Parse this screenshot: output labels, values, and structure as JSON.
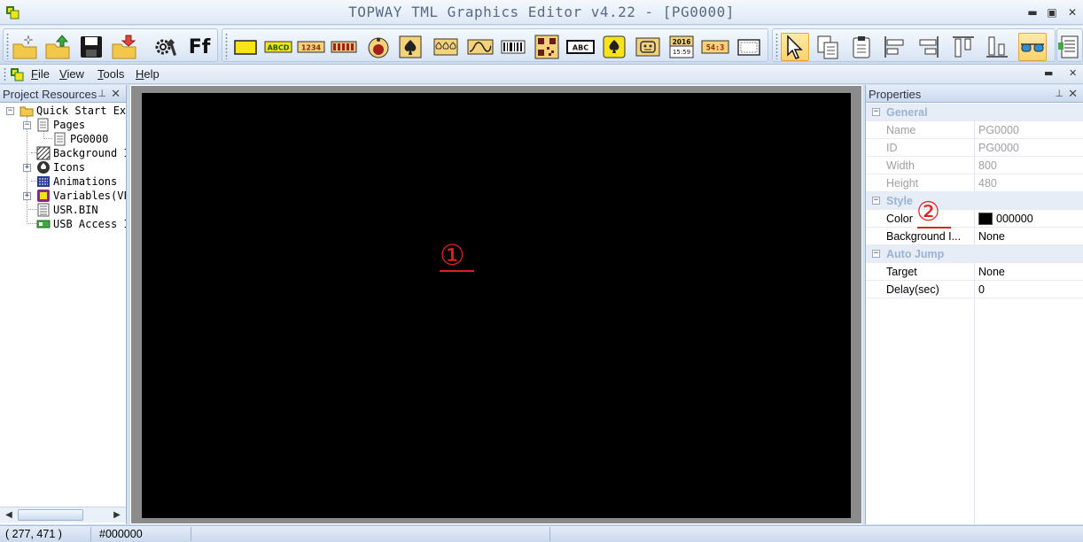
{
  "window": {
    "title": "TOPWAY TML Graphics Editor v4.22 - [PG0000]",
    "minimize_glyph": "▬",
    "restore_glyph": "▣",
    "close_glyph": "✕"
  },
  "toolbar": {
    "groups": [
      {
        "name": "file",
        "items": [
          "new-project-icon",
          "open-project-icon",
          "save-icon",
          "import-icon"
        ]
      },
      {
        "name": "settings",
        "items": [
          "settings-icon",
          "font-icon"
        ]
      },
      {
        "name": "widgets",
        "items": [
          "rectangle-icon",
          "text-abcd-icon",
          "number-1234-icon",
          "bar-icon",
          "gauge-icon",
          "icon-widget-icon",
          "animation-icon",
          "curve-icon",
          "barcode-icon",
          "qrcode-icon",
          "text-box-icon",
          "touch-icon",
          "robot-icon",
          "date-icon",
          "clock-icon",
          "frame-icon"
        ]
      },
      {
        "name": "edit",
        "items": [
          "select-pointer-icon",
          "copy-icon",
          "paste-icon",
          "align-left-icon",
          "align-right-icon",
          "align-top-icon",
          "align-bottom-icon",
          "preview-glasses-icon",
          "properties-list-icon"
        ]
      }
    ],
    "ff_label": "Ff",
    "abcd_label": "ABCD",
    "num_label": "1234",
    "abc_label": "ABC",
    "date_label": "2016",
    "date_sub": "15:59",
    "clock_label": "54:3"
  },
  "menu": {
    "items": [
      {
        "label": "File",
        "accel": "F",
        "rest": "ile"
      },
      {
        "label": "View",
        "accel": "V",
        "rest": "iew"
      },
      {
        "label": "Tools",
        "accel": "T",
        "rest": "ools"
      },
      {
        "label": "Help",
        "accel": "H",
        "rest": "elp"
      }
    ],
    "close_glyph": "✕",
    "minimize_glyph": "▬"
  },
  "project_panel": {
    "title": "Project Resources",
    "pin_glyph": "⊥",
    "close_glyph": "✕",
    "tree": [
      {
        "label": "Quick Start Ex",
        "level": 0,
        "expander": "−",
        "icon": "folder-icon"
      },
      {
        "label": "Pages",
        "level": 1,
        "expander": "−",
        "icon": "pages-icon"
      },
      {
        "label": "PG0000",
        "level": 2,
        "expander": "",
        "icon": "page-icon"
      },
      {
        "label": "Background I",
        "level": 1,
        "expander": "",
        "icon": "background-icon"
      },
      {
        "label": "Icons",
        "level": 1,
        "expander": "+",
        "icon": "icons-icon"
      },
      {
        "label": "Animations",
        "level": 1,
        "expander": "",
        "icon": "animations-icon"
      },
      {
        "label": "Variables(VP",
        "level": 1,
        "expander": "+",
        "icon": "variables-icon"
      },
      {
        "label": "USR.BIN",
        "level": 1,
        "expander": "",
        "icon": "usr-bin-icon"
      },
      {
        "label": "USB Access I",
        "level": 1,
        "expander": "",
        "icon": "usb-icon"
      }
    ],
    "scroll_left": "◀",
    "scroll_right": "▶",
    "scroll_grip": "|||"
  },
  "canvas": {
    "background": "#000000",
    "marker": "①"
  },
  "properties": {
    "title": "Properties",
    "pin_glyph": "⊥",
    "close_glyph": "✕",
    "marker": "②",
    "rows": [
      {
        "type": "category",
        "key": "General",
        "expander": "−"
      },
      {
        "type": "prop",
        "key": "Name",
        "value": "PG0000",
        "disabled": true
      },
      {
        "type": "prop",
        "key": "ID",
        "value": "PG0000",
        "disabled": true
      },
      {
        "type": "prop",
        "key": "Width",
        "value": "800",
        "disabled": true
      },
      {
        "type": "prop",
        "key": "Height",
        "value": "480",
        "disabled": true
      },
      {
        "type": "category",
        "key": "Style",
        "expander": "−"
      },
      {
        "type": "prop",
        "key": "Color",
        "value": "000000",
        "disabled": false,
        "swatch": "#000000"
      },
      {
        "type": "prop",
        "key": "Background I...",
        "value": "None",
        "disabled": false
      },
      {
        "type": "category",
        "key": "Auto Jump",
        "expander": "−"
      },
      {
        "type": "prop",
        "key": "Target",
        "value": "None",
        "disabled": false
      },
      {
        "type": "prop",
        "key": "Delay(sec)",
        "value": "0",
        "disabled": false
      }
    ]
  },
  "status": {
    "coords": "( 277, 471 )",
    "color": "#000000"
  },
  "colors": {
    "chrome_bg": "#d4e0f0",
    "accent_marker": "#e02020",
    "canvas_frame": "#8b8b8b"
  }
}
